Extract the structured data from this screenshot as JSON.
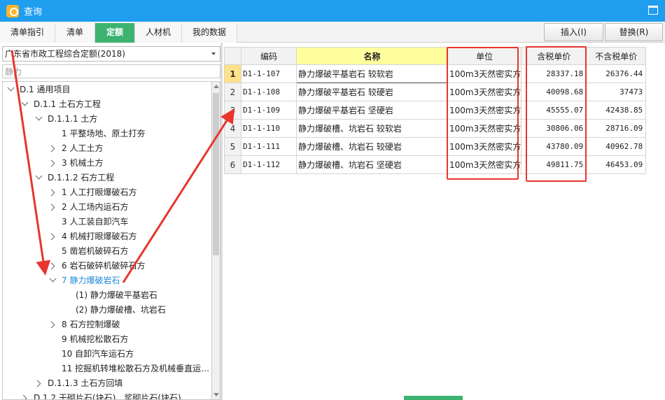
{
  "window": {
    "title": "查询"
  },
  "tabs": [
    {
      "label": "清单指引",
      "active": false
    },
    {
      "label": "清单",
      "active": false
    },
    {
      "label": "定额",
      "active": true
    },
    {
      "label": "人材机",
      "active": false
    },
    {
      "label": "我的数据",
      "active": false
    }
  ],
  "actions": {
    "insert": "插入(I)",
    "replace": "替换(R)"
  },
  "library": {
    "selected": "广东省市政工程综合定额(2018)"
  },
  "search": {
    "value": "静力"
  },
  "tree": [
    {
      "label": "D.1 通用项目",
      "depth": 0,
      "toggle": "expanded",
      "selected": false
    },
    {
      "label": "D.1.1 土石方工程",
      "depth": 1,
      "toggle": "expanded",
      "selected": false
    },
    {
      "label": "D.1.1.1 土方",
      "depth": 2,
      "toggle": "expanded",
      "selected": false
    },
    {
      "label": "1 平整场地、原土打夯",
      "depth": 3,
      "toggle": "none",
      "selected": false
    },
    {
      "label": "2 人工土方",
      "depth": 3,
      "toggle": "collapsed",
      "selected": false
    },
    {
      "label": "3 机械土方",
      "depth": 3,
      "toggle": "collapsed",
      "selected": false
    },
    {
      "label": "D.1.1.2 石方工程",
      "depth": 2,
      "toggle": "expanded",
      "selected": false
    },
    {
      "label": "1 人工打眼爆破石方",
      "depth": 3,
      "toggle": "collapsed",
      "selected": false
    },
    {
      "label": "2 人工场内运石方",
      "depth": 3,
      "toggle": "collapsed",
      "selected": false
    },
    {
      "label": "3 人工装自卸汽车",
      "depth": 3,
      "toggle": "none",
      "selected": false
    },
    {
      "label": "4 机械打眼爆破石方",
      "depth": 3,
      "toggle": "collapsed",
      "selected": false
    },
    {
      "label": "5 凿岩机破碎石方",
      "depth": 3,
      "toggle": "none",
      "selected": false
    },
    {
      "label": "6 岩石破碎机破碎石方",
      "depth": 3,
      "toggle": "collapsed",
      "selected": false
    },
    {
      "label": "7 静力爆破岩石",
      "depth": 3,
      "toggle": "expanded",
      "selected": true
    },
    {
      "label": "(1) 静力爆破平基岩石",
      "depth": 4,
      "toggle": "none",
      "selected": false
    },
    {
      "label": "(2) 静力爆破槽、坑岩石",
      "depth": 4,
      "toggle": "none",
      "selected": false
    },
    {
      "label": "8 石方控制爆破",
      "depth": 3,
      "toggle": "collapsed",
      "selected": false
    },
    {
      "label": "9 机械挖松散石方",
      "depth": 3,
      "toggle": "none",
      "selected": false
    },
    {
      "label": "10 自卸汽车运石方",
      "depth": 3,
      "toggle": "none",
      "selected": false
    },
    {
      "label": "11 挖掘机转堆松散石方及机械垂直运…",
      "depth": 3,
      "toggle": "none",
      "selected": false
    },
    {
      "label": "D.1.1.3 土石方回填",
      "depth": 2,
      "toggle": "collapsed",
      "selected": false
    },
    {
      "label": "D.1.2 干砌片石(块石)、浆砌片石(块石)、…",
      "depth": 1,
      "toggle": "collapsed",
      "selected": false
    }
  ],
  "grid": {
    "columns": [
      "编码",
      "名称",
      "单位",
      "含税单价",
      "不含税单价"
    ],
    "rows": [
      {
        "no": "1",
        "code": "D1-1-107",
        "name": "静力爆破平基岩石 较软岩",
        "unit": "100m3天然密实方",
        "price_tax": "28337.18",
        "price_notax": "26376.44"
      },
      {
        "no": "2",
        "code": "D1-1-108",
        "name": "静力爆破平基岩石 较硬岩",
        "unit": "100m3天然密实方",
        "price_tax": "40098.68",
        "price_notax": "37473"
      },
      {
        "no": "3",
        "code": "D1-1-109",
        "name": "静力爆破平基岩石 坚硬岩",
        "unit": "100m3天然密实方",
        "price_tax": "45555.07",
        "price_notax": "42438.85"
      },
      {
        "no": "4",
        "code": "D1-1-110",
        "name": "静力爆破槽、坑岩石 较软岩",
        "unit": "100m3天然密实方",
        "price_tax": "30806.06",
        "price_notax": "28716.09"
      },
      {
        "no": "5",
        "code": "D1-1-111",
        "name": "静力爆破槽、坑岩石 较硬岩",
        "unit": "100m3天然密实方",
        "price_tax": "43780.09",
        "price_notax": "40962.78"
      },
      {
        "no": "6",
        "code": "D1-1-112",
        "name": "静力爆破槽、坑岩石 坚硬岩",
        "unit": "100m3天然密实方",
        "price_tax": "49811.75",
        "price_notax": "46453.09"
      }
    ]
  },
  "colors": {
    "accent": "#1f9ef0",
    "active_tab": "#3cb371",
    "highlight": "#e8362c",
    "selected_tree": "#1e8ad8"
  }
}
